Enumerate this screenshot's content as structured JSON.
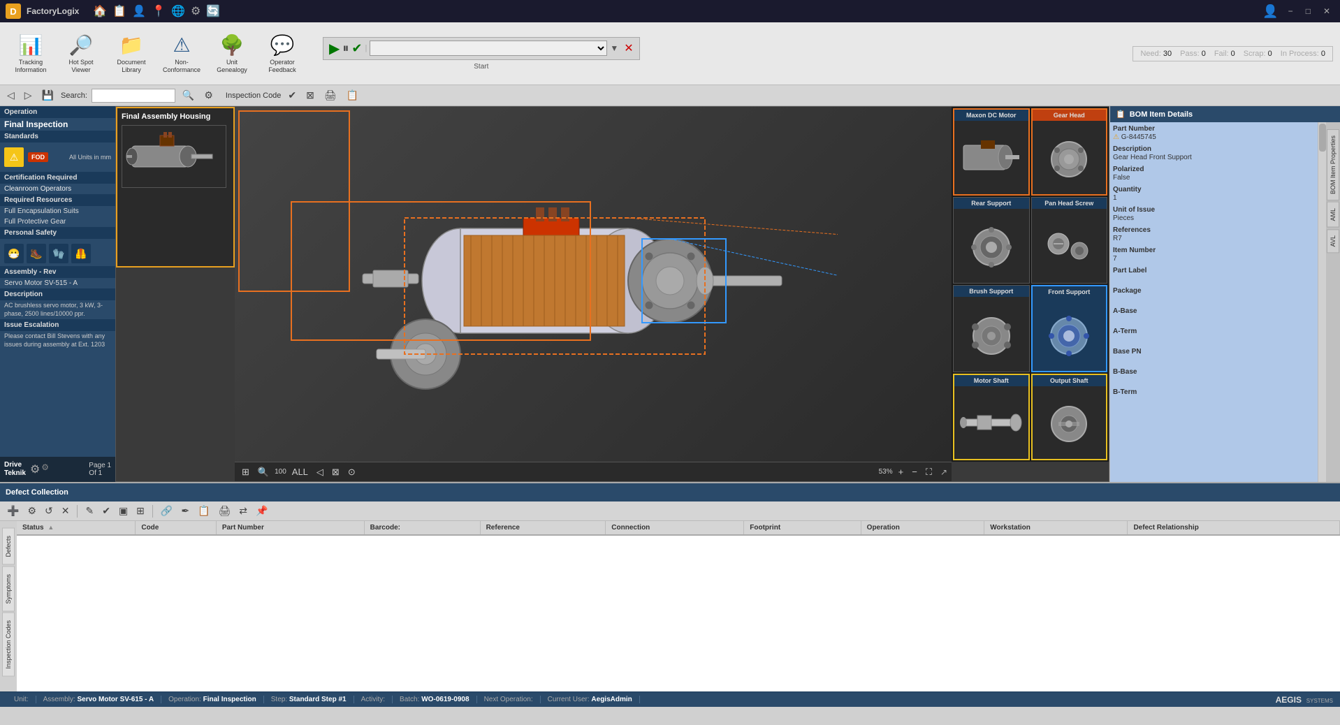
{
  "app": {
    "name": "FactoryLogix",
    "icon_letter": "D"
  },
  "title_bar": {
    "nav_icons": [
      "🏠",
      "📋",
      "👤",
      "📍",
      "🌐",
      "⚙",
      "🔄"
    ],
    "user_icon": "👤",
    "win_controls": [
      "−",
      "□",
      "✕"
    ]
  },
  "toolbar": {
    "buttons": [
      {
        "id": "tracking-info",
        "label": "Tracking Information",
        "icon": "📊"
      },
      {
        "id": "hot-spot-viewer",
        "label": "Hot Spot Viewer",
        "icon": "🔥"
      },
      {
        "id": "document-library",
        "label": "Document Library",
        "icon": "📁"
      },
      {
        "id": "non-conformance",
        "label": "Non-Conformance",
        "icon": "⚠"
      },
      {
        "id": "unit-genealogy",
        "label": "Unit Genealogy",
        "icon": "🌳"
      },
      {
        "id": "operator-feedback",
        "label": "Operator Feedback",
        "icon": "💬"
      }
    ]
  },
  "secondary_toolbar": {
    "buttons": [
      "◁",
      "▷",
      "💾",
      "🔍"
    ],
    "search_label": "Search:",
    "search_placeholder": "",
    "search_icon": "🔍",
    "settings_icon": "⚙",
    "inspection_code_label": "Inspection Code",
    "action_icons": [
      "✔",
      "⊠",
      "🖨",
      "📋"
    ]
  },
  "need_bar": {
    "need_label": "Need:",
    "need_value": "30",
    "pass_label": "Pass:",
    "pass_value": "0",
    "fail_label": "Fail:",
    "fail_value": "0",
    "scrap_label": "Scrap:",
    "scrap_value": "0",
    "in_process_label": "In Process:",
    "in_process_value": "0"
  },
  "playback": {
    "play_icon": "▶",
    "pause_icon": "⏸",
    "check_icon": "✔",
    "dropdown_placeholder": "",
    "close_icon": "✕",
    "start_label": "Start"
  },
  "left_panel": {
    "operation_header": "Operation",
    "operation_name": "Final Inspection",
    "standards_header": "Standards",
    "fod_label": "FOD",
    "units_label": "All Units in mm",
    "cert_required_header": "Certification Required",
    "cert_value": "Cleanroom Operators",
    "req_resources_header": "Required Resources",
    "resources": [
      "Full Encapsulation Suits",
      "Full Protective Gear"
    ],
    "personal_safety_header": "Personal Safety",
    "safety_icons": [
      "😷",
      "🥾",
      "🧤",
      "🦺"
    ],
    "assembly_rev_header": "Assembly - Rev",
    "assembly_rev_value": "Servo Motor SV-515 - A",
    "description_header": "Description",
    "description_text": "AC brushless servo motor, 3 kW, 3-phase, 2500 lines/10000 ppr.",
    "issue_escalation_header": "Issue Escalation",
    "issue_text": "Please contact Bill Stevens with any issues during assembly at Ext. 1203",
    "footer_logo": "Drive\nTeknik",
    "footer_page_label": "Page",
    "footer_page_value": "1",
    "footer_of_label": "Of",
    "footer_of_value": "1"
  },
  "assembly_housing": {
    "title": "Final Assembly Housing",
    "image_alt": "DC Motor Assembly"
  },
  "components": [
    {
      "id": "maxon-dc-motor",
      "label": "Maxon DC Motor",
      "highlight": "orange",
      "img_shape": "cylinder"
    },
    {
      "id": "gear-head",
      "label": "Gear Head",
      "highlight": "orange",
      "img_shape": "gear"
    },
    {
      "id": "rear-support",
      "label": "Rear Support",
      "highlight": "none",
      "img_shape": "circle"
    },
    {
      "id": "pan-head-screw",
      "label": "Pan Head Screw",
      "highlight": "none",
      "img_shape": "circle"
    },
    {
      "id": "brush-support",
      "label": "Brush Support",
      "highlight": "none",
      "img_shape": "circle"
    },
    {
      "id": "front-support",
      "label": "Front Support",
      "highlight": "blue",
      "img_shape": "circle"
    },
    {
      "id": "motor-shaft",
      "label": "Motor Shaft",
      "highlight": "yellow",
      "img_shape": "shaft"
    },
    {
      "id": "output-shaft",
      "label": "Output Shaft",
      "highlight": "yellow",
      "img_shape": "circle"
    }
  ],
  "bom_details": {
    "header": "BOM Item Details",
    "fields": [
      {
        "label": "Part Number",
        "value": "G-8445745",
        "warning": true
      },
      {
        "label": "Description",
        "value": "Gear Head Front Support"
      },
      {
        "label": "Polarized",
        "value": "False"
      },
      {
        "label": "Quantity",
        "value": "1"
      },
      {
        "label": "Unit of Issue",
        "value": "Pieces"
      },
      {
        "label": "References",
        "value": "R7"
      },
      {
        "label": "Item Number",
        "value": "7"
      },
      {
        "label": "Part Label",
        "value": ""
      },
      {
        "label": "Package",
        "value": ""
      },
      {
        "label": "A-Base",
        "value": ""
      },
      {
        "label": "A-Term",
        "value": ""
      },
      {
        "label": "Base PN",
        "value": ""
      },
      {
        "label": "B-Base",
        "value": ""
      }
    ],
    "side_tabs": [
      "BOM Item Properties",
      "AML",
      "AVL"
    ]
  },
  "defect_collection": {
    "header": "Defect Collection",
    "toolbar_icons": [
      "➕",
      "⚙",
      "↺",
      "✕",
      "✎",
      "✔",
      "▣",
      "⊞",
      "🔗",
      "✒",
      "📋",
      "🖨",
      "⇄",
      "📌"
    ],
    "columns": [
      {
        "id": "status",
        "label": "Status",
        "sortable": true
      },
      {
        "id": "code",
        "label": "Code",
        "sortable": false
      },
      {
        "id": "part-number",
        "label": "Part Number",
        "sortable": false
      },
      {
        "id": "barcode",
        "label": "Barcode:",
        "sortable": false
      },
      {
        "id": "reference",
        "label": "Reference",
        "sortable": false
      },
      {
        "id": "connection",
        "label": "Connection",
        "sortable": false
      },
      {
        "id": "footprint",
        "label": "Footprint",
        "sortable": false
      },
      {
        "id": "operation",
        "label": "Operation",
        "sortable": false
      },
      {
        "id": "workstation",
        "label": "Workstation",
        "sortable": false
      },
      {
        "id": "defect-relationship",
        "label": "Defect Relationship",
        "sortable": false
      }
    ],
    "rows": [],
    "side_tabs": [
      "Defects",
      "Symptoms",
      "Inspection Codes"
    ]
  },
  "status_bar": {
    "unit_label": "Unit:",
    "unit_value": "",
    "assembly_label": "Assembly:",
    "assembly_value": "Servo Motor SV-615 - A",
    "operation_label": "Operation:",
    "operation_value": "Final Inspection",
    "step_label": "Step:",
    "step_value": "Standard Step #1",
    "activity_label": "Activity:",
    "activity_value": "",
    "batch_label": "Batch:",
    "batch_value": "WO-0619-0908",
    "next_op_label": "Next Operation:",
    "next_op_value": "",
    "current_user_label": "Current User:",
    "current_user_value": "AegisAdmin",
    "brand": "AEGIS"
  },
  "viewer_bottom": {
    "icons": [
      "⊞",
      "🔍",
      "100",
      "ALL",
      "◁",
      "⊠",
      "⊙"
    ],
    "zoom_label": "53%",
    "fit_icon": "⊞",
    "zoom_in_icon": "+"
  }
}
